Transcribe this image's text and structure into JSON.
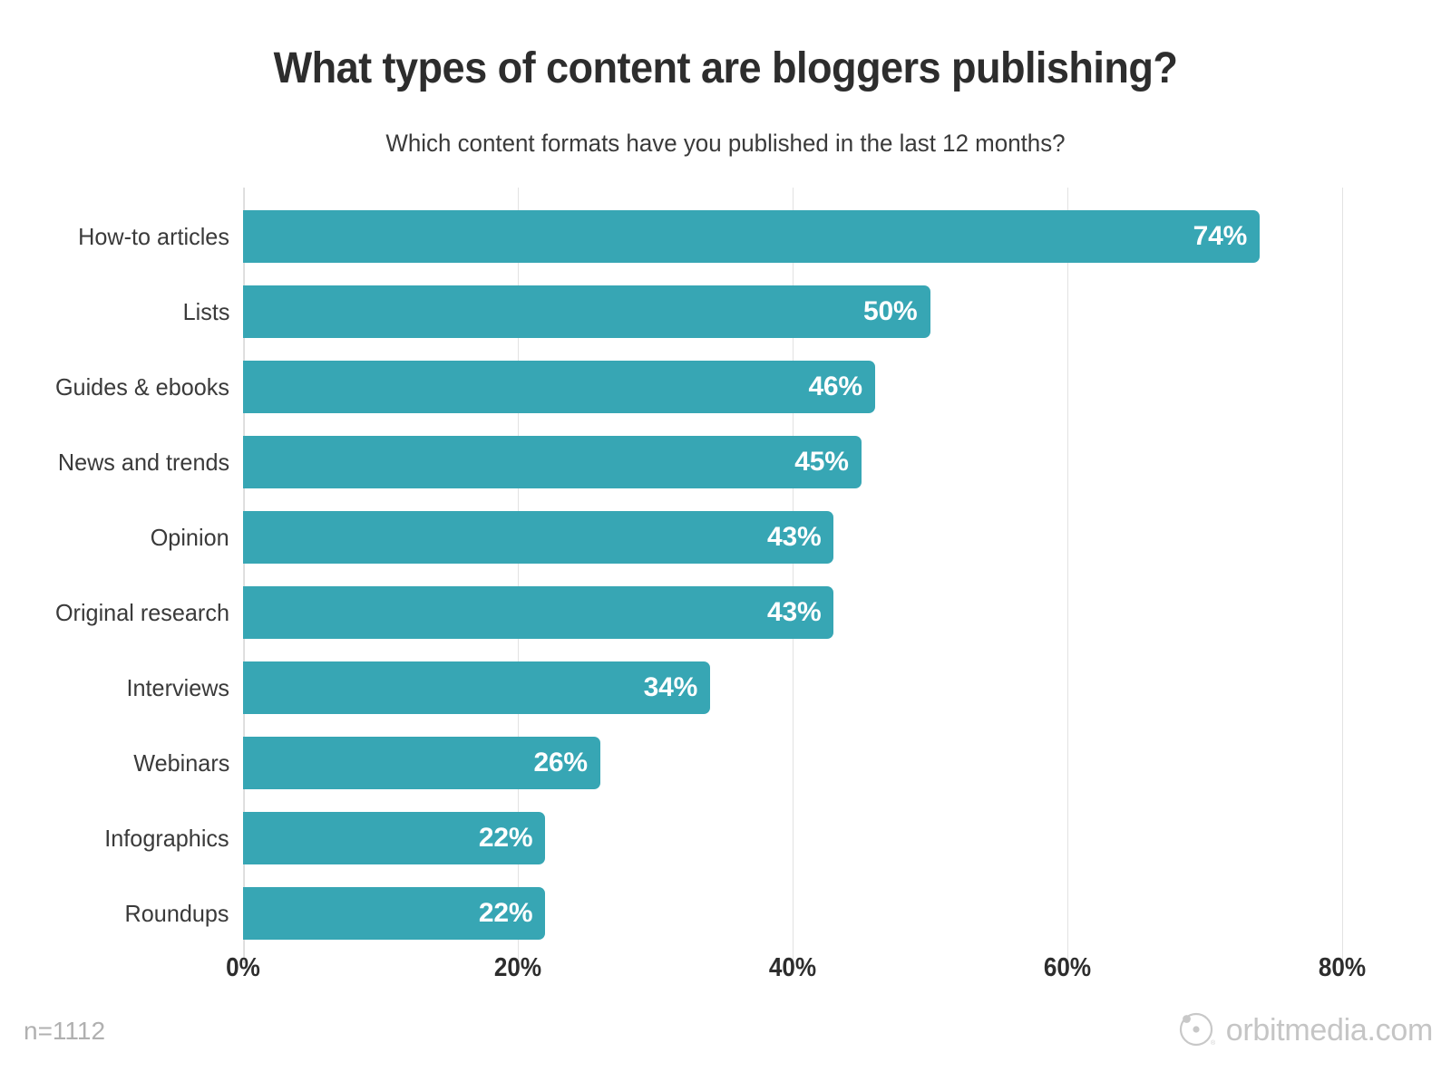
{
  "chart_data": {
    "type": "bar",
    "orientation": "horizontal",
    "title": "What types of content are bloggers publishing?",
    "subtitle": "Which content formats have you published in the last 12 months?",
    "xlabel": "",
    "ylabel": "",
    "categories": [
      "How-to articles",
      "Lists",
      "Guides & ebooks",
      "News and trends",
      "Opinion",
      "Original research",
      "Interviews",
      "Webinars",
      "Infographics",
      "Roundups"
    ],
    "values": [
      74,
      50,
      46,
      45,
      43,
      43,
      34,
      26,
      22,
      22
    ],
    "value_labels": [
      "74%",
      "50%",
      "46%",
      "45%",
      "43%",
      "43%",
      "34%",
      "26%",
      "22%",
      "22%"
    ],
    "xlim": [
      0,
      80
    ],
    "xticks": [
      0,
      20,
      40,
      60,
      80
    ],
    "xtick_labels": [
      "0%",
      "20%",
      "40%",
      "60%",
      "80%"
    ],
    "grid": true,
    "grid_axis": "x",
    "legend": false,
    "bar_color": "#37a6b4",
    "value_label_color": "#ffffff",
    "background_color": "#ffffff"
  },
  "footer": {
    "sample_size": "n=1112",
    "logo_text": "orbitmedia.com",
    "logo_icon": "orbit-circle-icon",
    "logo_color": "#c5c5c5"
  }
}
